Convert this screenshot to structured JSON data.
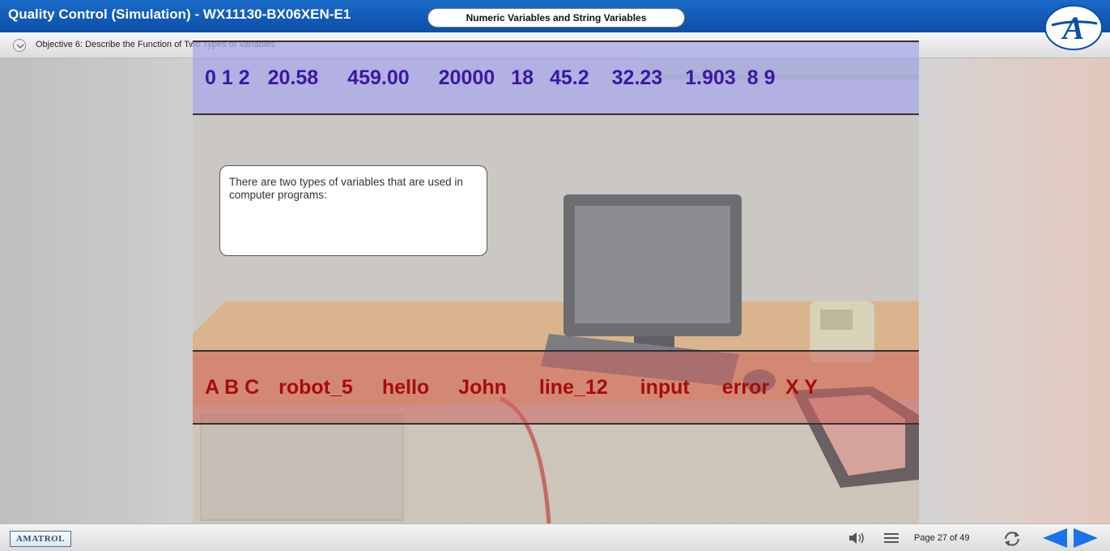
{
  "window": {
    "title": "Quality Control (Simulation) - WX11130-BX06XEN-E1"
  },
  "objective": {
    "label": "Objective 6: Describe the Function of Two Types of Variables"
  },
  "lesson": {
    "subtitle": "Numeric Variables and String Variables",
    "numeric_band": [
      "0 1 2",
      "20.58",
      "459.00",
      "20000",
      "18",
      "45.2",
      "32.23",
      "1.903",
      "8 9"
    ],
    "string_band": [
      "A B C",
      "robot_5",
      "hello",
      "John",
      "line_12",
      "input",
      "error",
      "X Y"
    ],
    "callout_text": "There are two types of variables that are used in computer programs:"
  },
  "footer": {
    "brand": "AMATROL",
    "page_indicator": "Page 27 of 49"
  },
  "icons": [
    "chevron-down-icon",
    "amatrol-a-logo",
    "speaker-icon",
    "menu-icon",
    "refresh-icon",
    "prev-arrow-icon",
    "next-arrow-icon"
  ],
  "colors": {
    "title_bar": "#0c4fa8",
    "numeric_text": "#3b18a6",
    "string_text": "#a50d0d",
    "nav_arrows": "#1a73e8"
  }
}
